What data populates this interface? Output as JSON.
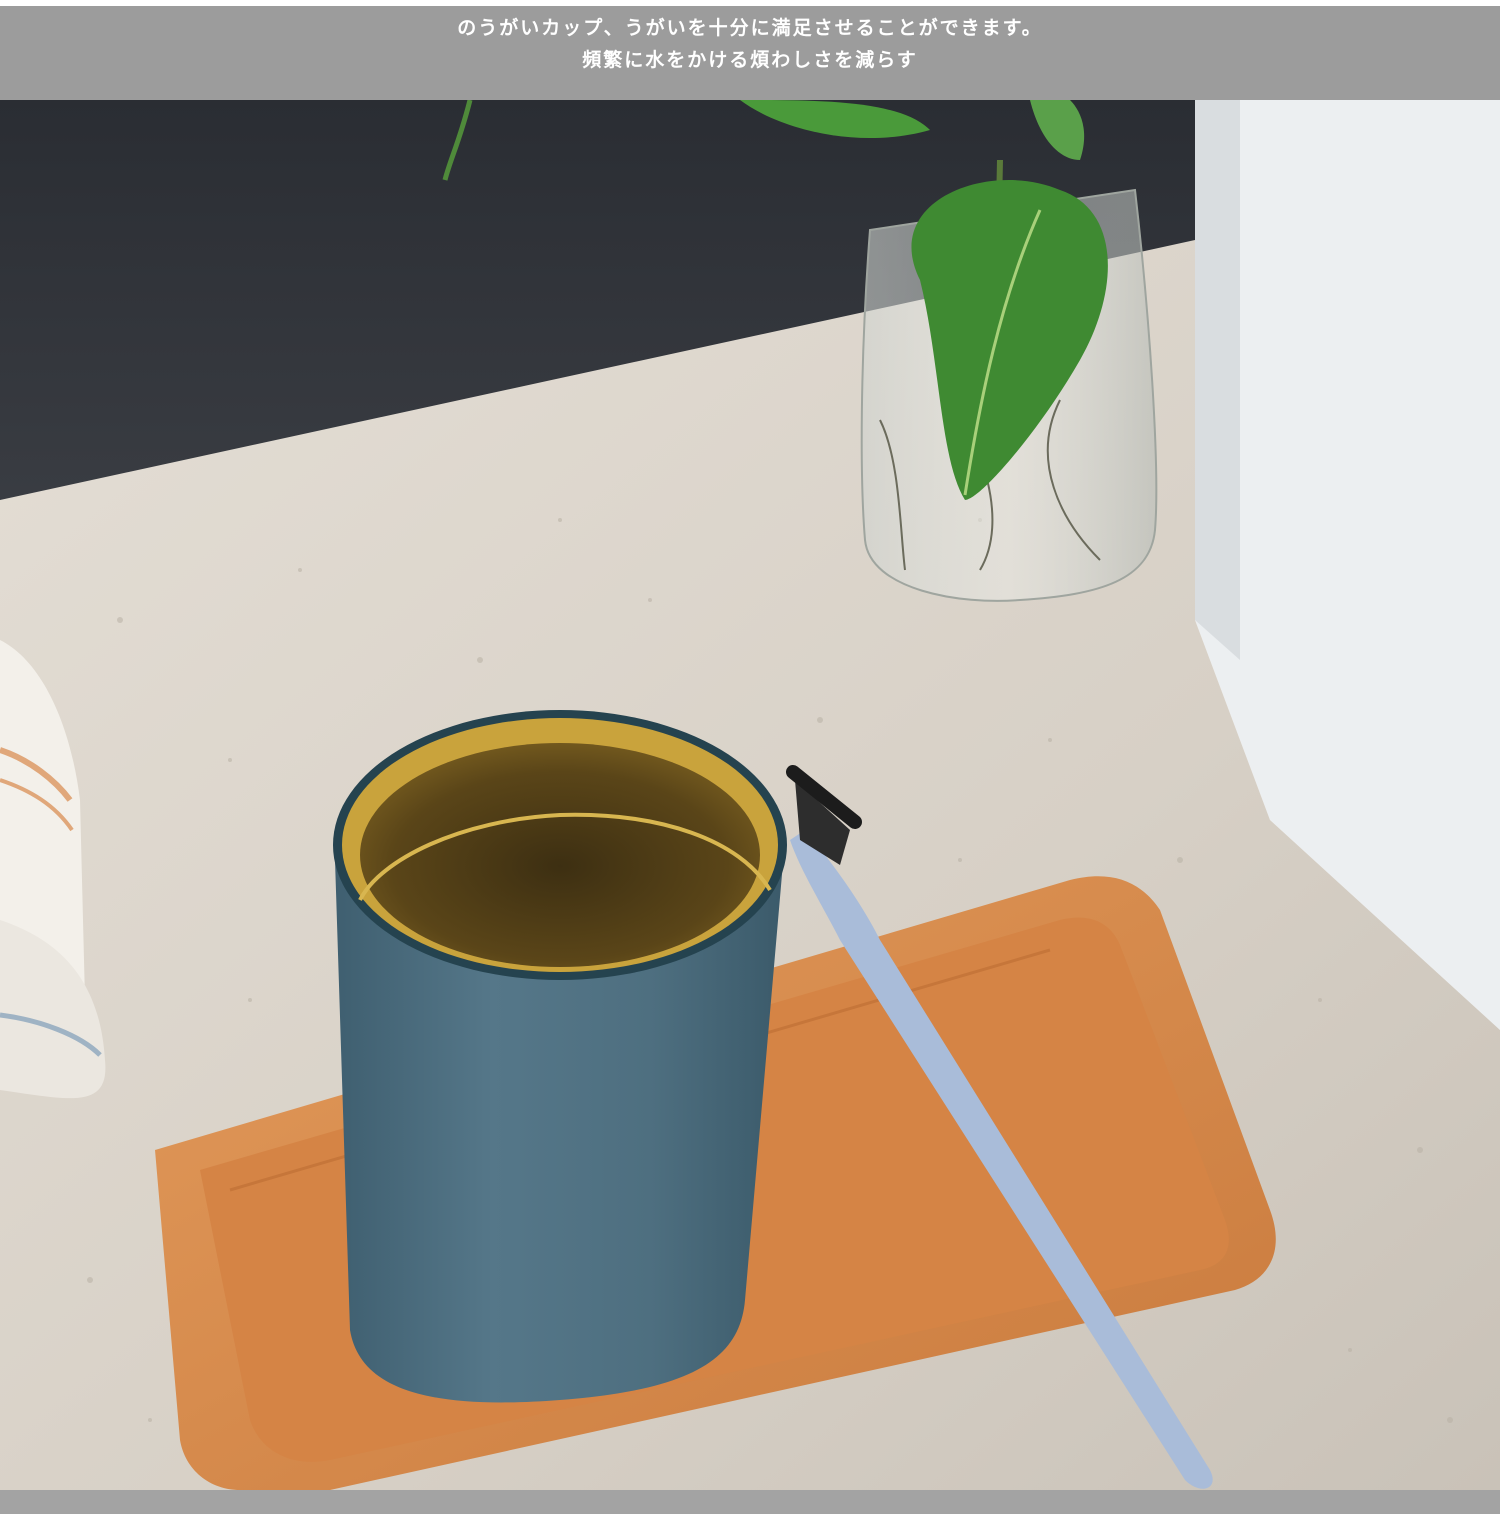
{
  "header": {
    "line1": "のうがいカップ、うがいを十分に満足させることができます。",
    "line2": "頻繁に水をかける煩わしさを減らす"
  },
  "colors": {
    "band": "#9c9c9c",
    "cup_outer": "#4e6f80",
    "cup_inner": "#c9a33c",
    "tray_wood": "#d98c4e",
    "toothbrush": "#a9bcd9",
    "counter": "#ddd6cc",
    "wall": "#2f3238"
  },
  "photo": {
    "subject": "cup-on-tray",
    "icons": [
      "cup-icon",
      "tray-icon",
      "toothbrush-icon",
      "plant-icon",
      "towel-icon"
    ]
  }
}
